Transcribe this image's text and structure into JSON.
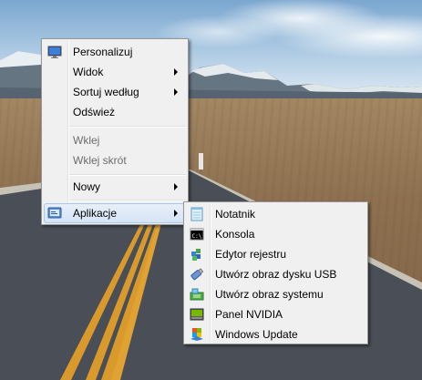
{
  "context_menu": {
    "items": [
      {
        "label": "Personalizuj",
        "icon": "monitor-icon",
        "enabled": true
      },
      {
        "label": "Widok",
        "submenu": true,
        "enabled": true
      },
      {
        "label": "Sortuj według",
        "submenu": true,
        "enabled": true
      },
      {
        "label": "Odśwież",
        "enabled": true
      },
      {
        "label": "Wklej",
        "enabled": false
      },
      {
        "label": "Wklej skrót",
        "enabled": false
      },
      {
        "label": "Nowy",
        "submenu": true,
        "enabled": true
      },
      {
        "label": "Aplikacje",
        "icon": "apps-icon",
        "submenu": true,
        "enabled": true,
        "highlighted": true
      }
    ]
  },
  "apps_submenu": {
    "items": [
      {
        "label": "Notatnik",
        "icon": "notepad-icon"
      },
      {
        "label": "Konsola",
        "icon": "console-icon"
      },
      {
        "label": "Edytor rejestru",
        "icon": "registry-editor-icon"
      },
      {
        "label": "Utwórz obraz dysku USB",
        "icon": "usb-drive-icon"
      },
      {
        "label": "Utwórz obraz systemu",
        "icon": "system-image-icon"
      },
      {
        "label": "Panel NVIDIA",
        "icon": "nvidia-icon"
      },
      {
        "label": "Windows Update",
        "icon": "windows-update-icon"
      }
    ]
  },
  "colors": {
    "menu_background": "#f0f0f0",
    "menu_border": "#979797",
    "highlight_border": "#a8c8ec",
    "disabled_text": "#6d6d6d"
  }
}
